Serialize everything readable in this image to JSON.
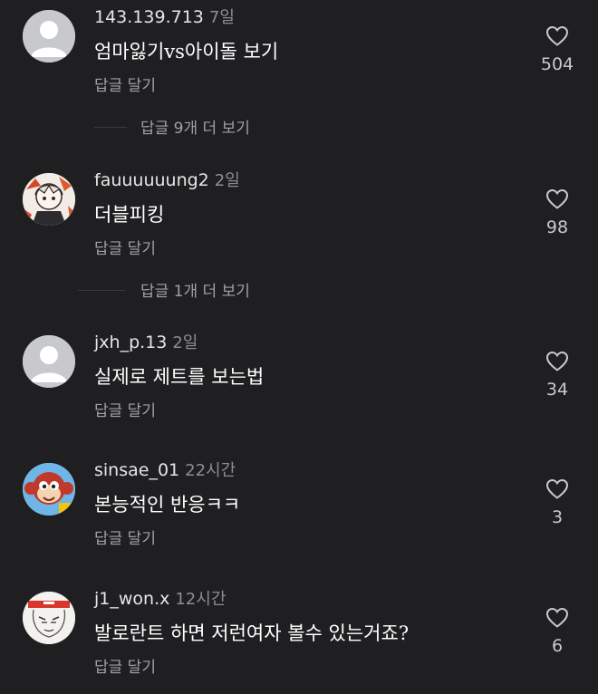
{
  "reply_label": "답글 달기",
  "comments": [
    {
      "username": "143.139.713",
      "time": "7일",
      "text": "엄마잃기vs아이돌 보기",
      "likes": "504",
      "view_replies": "답글 9개 더 보기",
      "avatar": "default-person-icon"
    },
    {
      "username": "fauuuuuung2",
      "time": "2일",
      "text": "더블피킹",
      "likes": "98",
      "view_replies": "답글 1개 더 보기",
      "avatar": "anime-character-avatar"
    },
    {
      "username": "jxh_p.13",
      "time": "2일",
      "text": "실제로 제트를 보는법",
      "likes": "34",
      "avatar": "default-person-icon"
    },
    {
      "username": "sinsae_01",
      "time": "22시간",
      "text": "본능적인 반응ㅋㅋ",
      "likes": "3",
      "avatar": "cartoon-monkey-avatar"
    },
    {
      "username": "j1_won.x",
      "time": "12시간",
      "text": "발로란트 하면 저런여자 볼수 있는거죠?",
      "likes": "6",
      "avatar": "sketch-face-avatar"
    }
  ]
}
